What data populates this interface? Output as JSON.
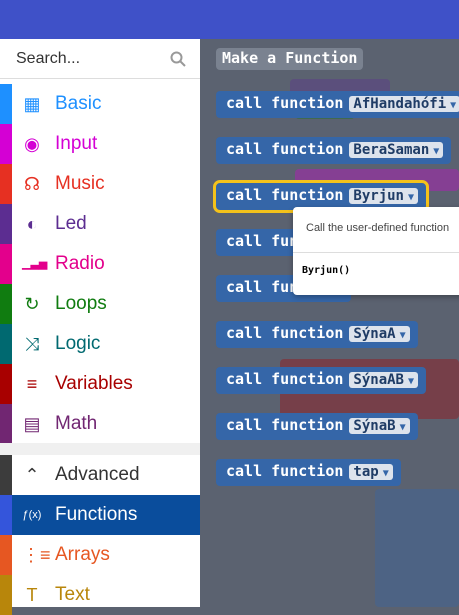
{
  "search": {
    "placeholder": "Search..."
  },
  "categories": [
    {
      "label": "Basic",
      "color": "#1e90ff",
      "icon": "grid-icon",
      "glyph": "▦"
    },
    {
      "label": "Input",
      "color": "#d400d4",
      "icon": "target-icon",
      "glyph": "◉"
    },
    {
      "label": "Music",
      "color": "#e63022",
      "icon": "headphones-icon",
      "glyph": "☊"
    },
    {
      "label": "Led",
      "color": "#5c2d91",
      "icon": "toggle-icon",
      "glyph": "◐"
    },
    {
      "label": "Radio",
      "color": "#e3008c",
      "icon": "signal-icon",
      "glyph": "▁▃▅"
    },
    {
      "label": "Loops",
      "color": "#107c10",
      "icon": "refresh-icon",
      "glyph": "↻"
    },
    {
      "label": "Logic",
      "color": "#006970",
      "icon": "shuffle-icon",
      "glyph": "⤨"
    },
    {
      "label": "Variables",
      "color": "#a80000",
      "icon": "list-icon",
      "glyph": "≡"
    },
    {
      "label": "Math",
      "color": "#712672",
      "icon": "calculator-icon",
      "glyph": "▤"
    },
    {
      "label": "Advanced",
      "color": "#3c3c3c",
      "icon": "chevron-up-icon",
      "glyph": "⌃"
    },
    {
      "label": "Functions",
      "color": "#3455db",
      "icon": "function-icon",
      "glyph": "ƒ(x)"
    },
    {
      "label": "Arrays",
      "color": "#e65722",
      "icon": "numbered-list-icon",
      "glyph": "⋮≡"
    },
    {
      "label": "Text",
      "color": "#b8860b",
      "icon": "text-icon",
      "glyph": "T"
    }
  ],
  "workspace": {
    "title": "Make a Function",
    "call_label": "call function",
    "functions": [
      "AfHandahófi",
      "BeraSaman",
      "Byrjun",
      "",
      "",
      "SýnaA",
      "SýnaAB",
      "SýnaB",
      "tap"
    ]
  },
  "tooltip": {
    "description": "Call the user-defined function",
    "signature": "Byrjun()"
  },
  "colors": {
    "topbar": "#3f51c8",
    "block": "#3566a8",
    "selected_outline": "#f4c21b",
    "functions_selected_bg": "#0a4d9c"
  }
}
